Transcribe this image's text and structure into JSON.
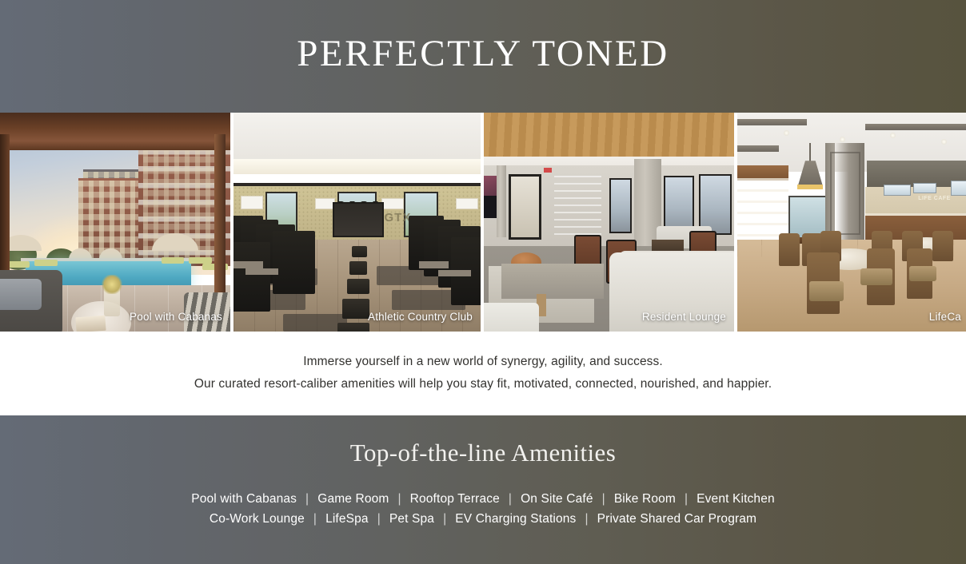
{
  "hero": {
    "title": "PERFECTLY TONED"
  },
  "gallery": {
    "photos": [
      {
        "caption": "Pool with Cabanas",
        "scene": "pool-with-cabanas-photo"
      },
      {
        "caption": "Athletic Country Club",
        "scene": "athletic-country-club-photo",
        "wall_sign": "GTX"
      },
      {
        "caption": "Resident Lounge",
        "scene": "resident-lounge-photo"
      },
      {
        "caption": "LifeCa",
        "scene": "lifecafe-photo",
        "wall_sign": "LIFE CAFE"
      }
    ]
  },
  "copy": {
    "line1": "Immerse yourself in a new world of synergy, agility, and success.",
    "line2": "Our curated resort-caliber amenities will help you stay fit, motivated, connected, nourished, and happier."
  },
  "amenities": {
    "title": "Top-of-the-line Amenities",
    "separator": "|",
    "row1": [
      "Pool with Cabanas",
      "Game Room",
      "Rooftop Terrace",
      "On Site Café",
      "Bike Room",
      "Event Kitchen"
    ],
    "row2": [
      "Co-Work Lounge",
      "LifeSpa",
      "Pet Spa",
      "EV Charging Stations",
      "Private Shared Car Program"
    ]
  },
  "colors": {
    "band_gradient_left": "#646b76",
    "band_gradient_right": "#57533e",
    "copy_text": "#33322f",
    "caption_text": "#ffffff"
  }
}
